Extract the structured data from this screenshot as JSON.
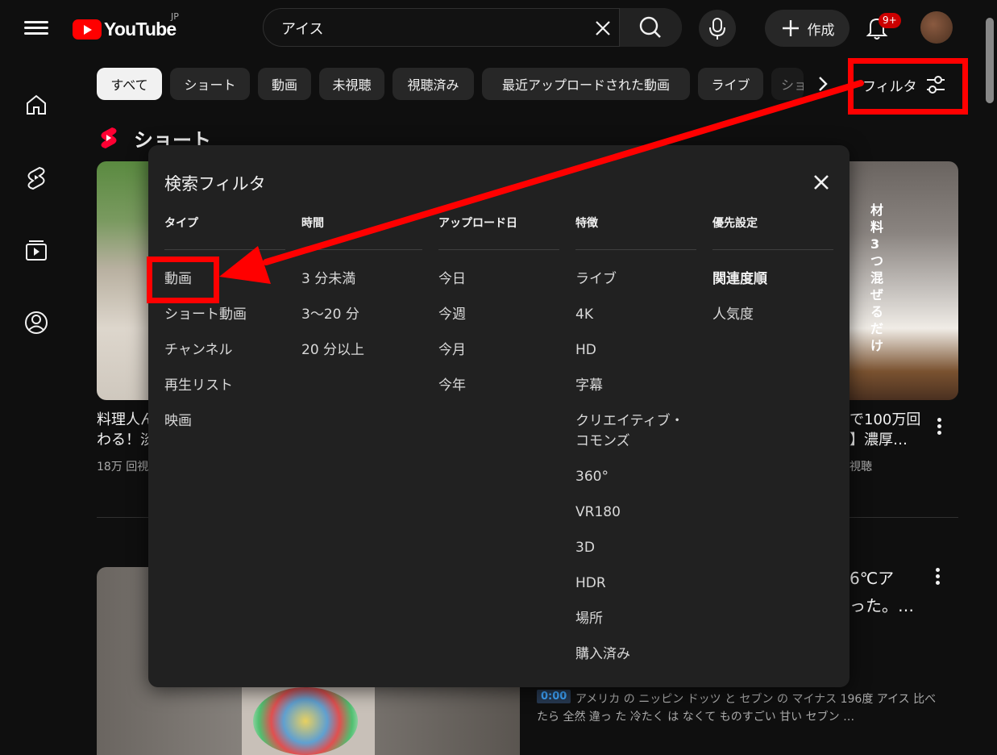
{
  "topbar": {
    "logo_text": "YouTube",
    "region": "JP",
    "search_value": "アイス",
    "create_label": "作成",
    "notification_count": "9+"
  },
  "chips": [
    {
      "label": "すべて"
    },
    {
      "label": "ショート"
    },
    {
      "label": "動画"
    },
    {
      "label": "未視聴"
    },
    {
      "label": "視聴済み"
    },
    {
      "label": "最近アップロードされた動画"
    },
    {
      "label": "ライブ"
    },
    {
      "label": "ショ"
    }
  ],
  "filter_label": "フィルタ",
  "shorts_section": {
    "title": "ショート",
    "left_card": {
      "title_line1": "料理人ん",
      "title_line2": "わる！淡",
      "views": "18万 回視"
    },
    "right_card": {
      "title_line1": "で100万回",
      "title_line2": "】濃厚…",
      "views": "視聴",
      "overlay_text": "材料3つ混ぜるだけ"
    }
  },
  "video_result": {
    "title_line1": "6℃ア",
    "title_line2": "った。…",
    "time": "0:00",
    "description_line1": "アメリカ の ニッピン ドッツ と セブン の マイナス 196度 アイス 比べ",
    "description_line2": "たら 全然 違っ た 冷たく は なくて ものすごい 甘い セブン …"
  },
  "dialog": {
    "title": "検索フィルタ",
    "columns": [
      {
        "header": "タイプ",
        "items": [
          "動画",
          "ショート動画",
          "チャンネル",
          "再生リスト",
          "映画"
        ]
      },
      {
        "header": "時間",
        "items": [
          "3 分未満",
          "3〜20 分",
          "20 分以上"
        ]
      },
      {
        "header": "アップロード日",
        "items": [
          "今日",
          "今週",
          "今月",
          "今年"
        ]
      },
      {
        "header": "特徴",
        "items": [
          "ライブ",
          "4K",
          "HD",
          "字幕",
          "クリエイティブ・コモンズ",
          "360°",
          "VR180",
          "3D",
          "HDR",
          "場所",
          "購入済み"
        ]
      },
      {
        "header": "優先設定",
        "items": [
          "関連度順",
          "人気度"
        ]
      }
    ]
  },
  "colors": {
    "accent": "#ff0000",
    "background": "#0f0f0f",
    "dialog": "#212121"
  }
}
